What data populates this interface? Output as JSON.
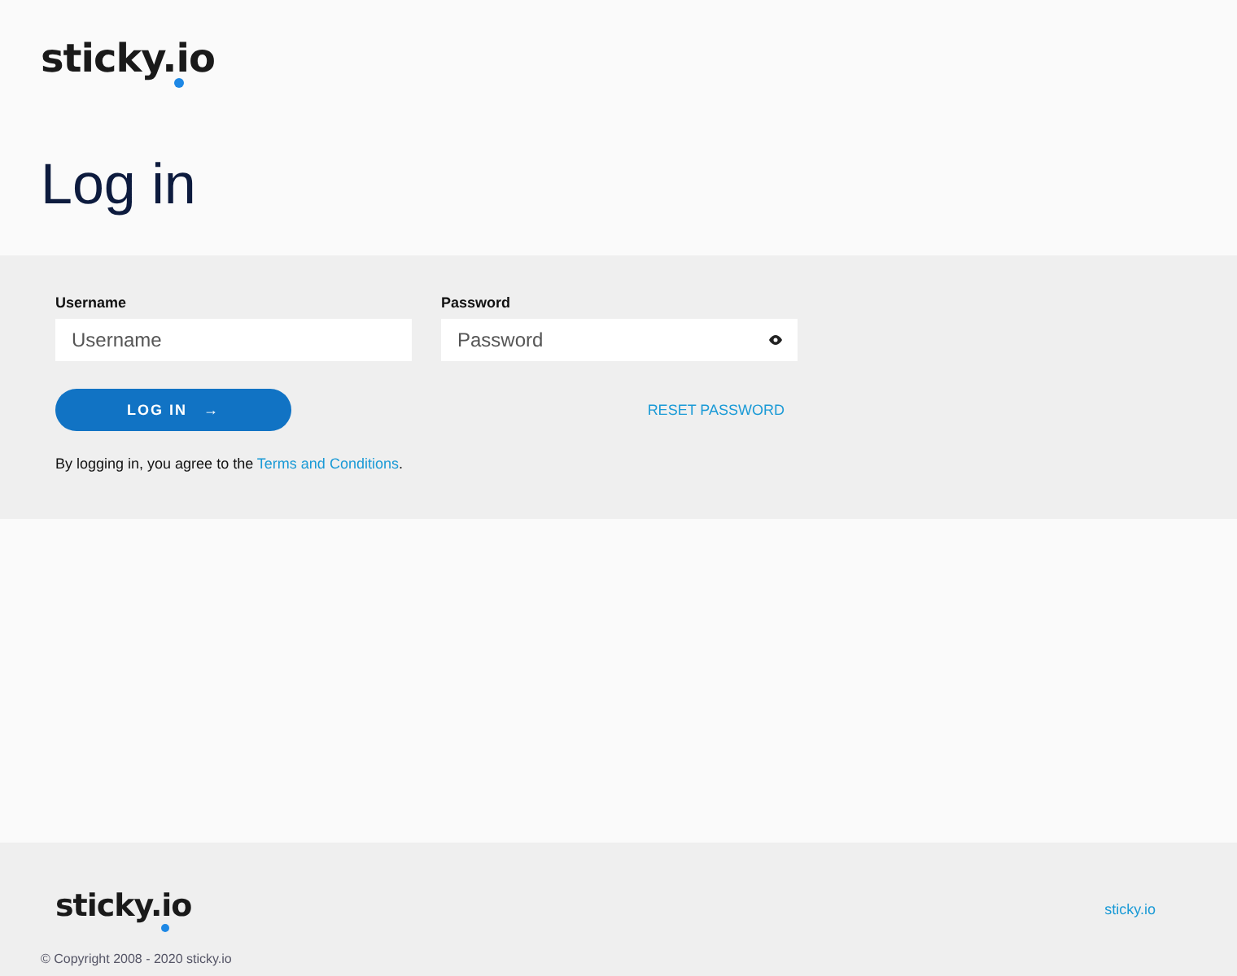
{
  "header": {
    "logo": "sticky.io",
    "title": "Log in"
  },
  "form": {
    "fields": [
      {
        "label": "Username",
        "placeholder": "Username",
        "kind": "text"
      },
      {
        "label": "Password",
        "placeholder": "Password",
        "kind": "password"
      }
    ],
    "login_button": "LOG IN",
    "login_arrow": "→",
    "reset_link": "RESET PASSWORD",
    "agreement": "By logging in, you agree to the ",
    "terms_link": "Terms and Conditions",
    "agreement_end": "."
  },
  "footer": {
    "logo": "sticky.io",
    "link": "sticky.io",
    "copyright": "© Copyright 2008 - 2020 sticky.io"
  }
}
